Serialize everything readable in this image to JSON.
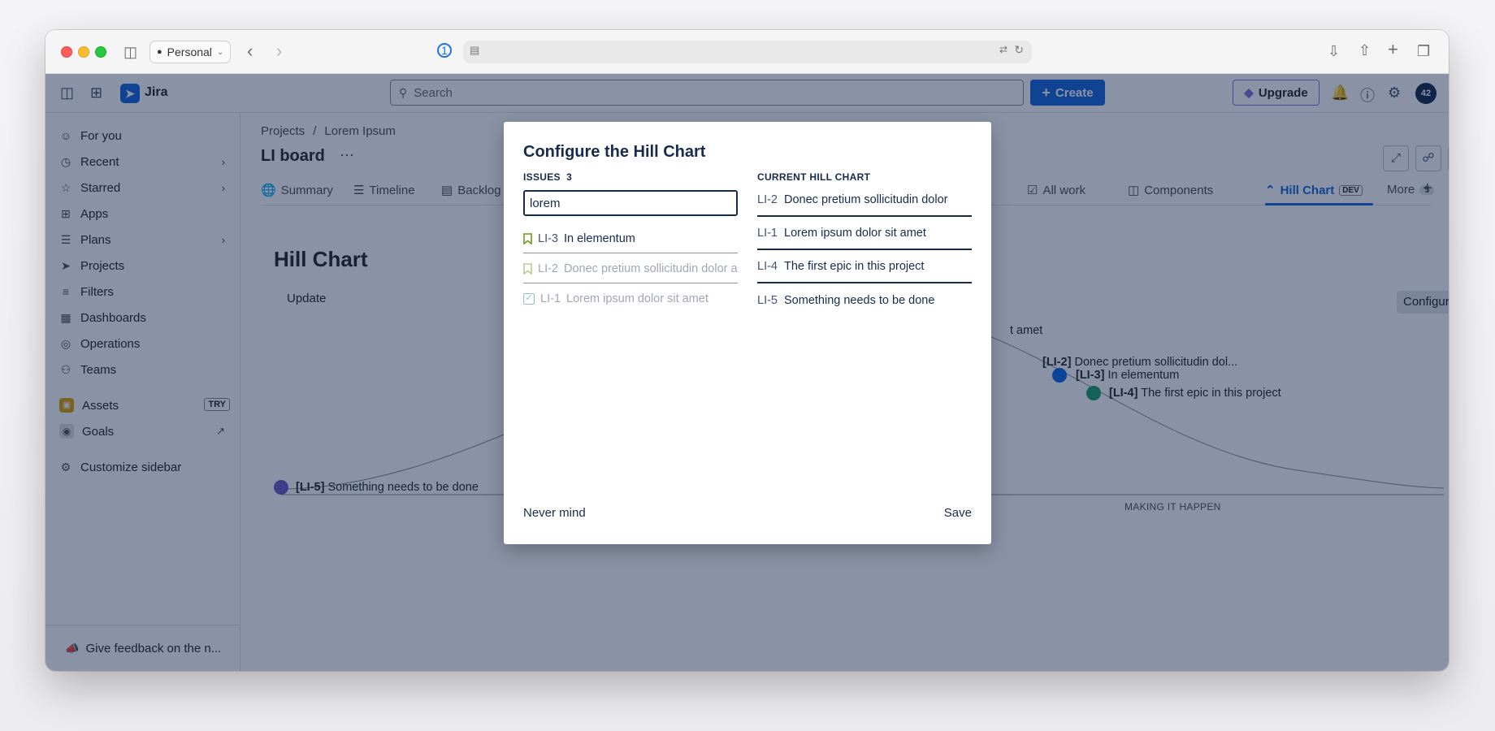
{
  "browser": {
    "profile_label": "Personal"
  },
  "jira": {
    "app_name": "Jira",
    "search_placeholder": "Search",
    "create_label": "Create",
    "upgrade_label": "Upgrade",
    "avatar_initials": "42"
  },
  "sidebar": {
    "items": [
      {
        "label": "For you",
        "icon": "user-circle-icon"
      },
      {
        "label": "Recent",
        "icon": "clock-icon"
      },
      {
        "label": "Starred",
        "icon": "star-icon"
      },
      {
        "label": "Apps",
        "icon": "apps-icon"
      },
      {
        "label": "Plans",
        "icon": "plans-icon"
      },
      {
        "label": "Projects",
        "icon": "rocket-icon"
      },
      {
        "label": "Filters",
        "icon": "filter-icon"
      },
      {
        "label": "Dashboards",
        "icon": "dashboard-icon"
      },
      {
        "label": "Operations",
        "icon": "operations-icon"
      },
      {
        "label": "Teams",
        "icon": "teams-icon"
      },
      {
        "label": "Assets",
        "icon": "assets-icon",
        "badge": "TRY"
      },
      {
        "label": "Goals",
        "icon": "goals-icon"
      },
      {
        "label": "Customize sidebar",
        "icon": "customize-icon"
      }
    ],
    "feedback_label": "Give feedback on the n..."
  },
  "main": {
    "breadcrumb": [
      "Projects",
      "Lorem Ipsum"
    ],
    "breadcrumb_sep": "/",
    "board_title": "LI board",
    "tabs": [
      {
        "label": "Summary"
      },
      {
        "label": "Timeline"
      },
      {
        "label": "Backlog"
      },
      {
        "label": "All work"
      },
      {
        "label": "Components"
      },
      {
        "label": "Hill Chart",
        "badge": "DEV"
      },
      {
        "label": "More",
        "count": "5"
      }
    ],
    "hill_title": "Hill Chart",
    "update_label": "Update",
    "configure_label": "Configure",
    "partial_label": "t amet",
    "phase_right": "MAKING IT HAPPEN",
    "points": [
      {
        "key": "[LI-2]",
        "title": "Donec pretium sollicitudin dol..."
      },
      {
        "key": "[LI-3]",
        "title": "In elementum",
        "color": "#0c66e4"
      },
      {
        "key": "[LI-4]",
        "title": "The first epic in this project",
        "color": "#22a06b"
      },
      {
        "key": "[LI-5]",
        "title": "Something needs to be done",
        "color": "#6e5dc6"
      }
    ]
  },
  "modal": {
    "title": "Configure the Hill Chart",
    "issues_label": "ISSUES",
    "issues_count": "3",
    "filter_value": "lorem",
    "issues": [
      {
        "key": "LI-3",
        "title": "In elementum",
        "state": "enabled"
      },
      {
        "key": "LI-2",
        "title": "Donec pretium sollicitudin dolor a",
        "state": "disabled"
      },
      {
        "key": "LI-1",
        "title": "Lorem ipsum dolor sit amet",
        "state": "disabled"
      }
    ],
    "current_label": "CURRENT HILL CHART",
    "current": [
      {
        "key": "LI-2",
        "title": "Donec pretium sollicitudin dolor"
      },
      {
        "key": "LI-1",
        "title": "Lorem ipsum dolor sit amet"
      },
      {
        "key": "LI-4",
        "title": "The first epic in this project"
      },
      {
        "key": "LI-5",
        "title": "Something needs to be done"
      }
    ],
    "cancel_label": "Never mind",
    "save_label": "Save"
  }
}
